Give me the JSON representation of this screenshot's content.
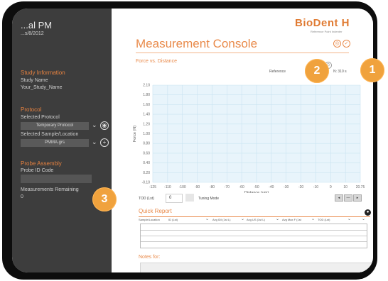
{
  "sidebar": {
    "time": "...al PM",
    "date": "...s/8/2012",
    "study_heading": "Study Information",
    "study_name_label": "Study Name",
    "study_name_value": "Your_Study_Name",
    "protocol_heading": "Protocol",
    "selected_protocol_label": "Selected Protocol",
    "selected_protocol_value": "Temporary Protocol",
    "selected_sample_label": "Selected Sample/Location",
    "selected_sample_value": "PMMA.grs",
    "probe_heading": "Probe Assembly",
    "probe_id_label": "Probe ID Code",
    "measurements_label": "Measurements Remaining",
    "measurements_value": "0"
  },
  "header": {
    "logo": "BioDent",
    "logo_suffix": "H",
    "logo_sub": "Reference Point Indenter",
    "title": "Measurement Console"
  },
  "chart": {
    "title": "Force vs. Distance",
    "reference_label": "Reference",
    "reference_value": "N: 310 s"
  },
  "chart_data": {
    "type": "line",
    "xlabel": "Distance (µm)",
    "ylabel": "Force (N)",
    "x_ticks": [
      "-125",
      "-110",
      "-100",
      "-90",
      "-80",
      "-70",
      "-60",
      "-50",
      "-40",
      "-30",
      "-20",
      "-10",
      "0",
      "10",
      "20.75"
    ],
    "y_ticks": [
      "2.10",
      "1.80",
      "1.60",
      "1.40",
      "1.20",
      "1.00",
      "0.80",
      "0.60",
      "0.40",
      "0.20",
      "-0.10"
    ],
    "xlim": [
      -125,
      20.75
    ],
    "ylim": [
      -0.1,
      2.1
    ],
    "grid": true,
    "series": [],
    "plot_color": "#e8f4fb",
    "grid_color": "#c9e3f1"
  },
  "controls": {
    "tod_label": "TOD (Lst)",
    "tod_value": "0",
    "tuning_label": "Tuning Mode",
    "pan_left": "◂",
    "pan_mid": "—",
    "pan_right": "▸"
  },
  "quick_report": {
    "title": "Quick Report",
    "columns": [
      "Sample/Location",
      "ID (Lst)",
      "Avg IDI (1st L)",
      "Avg US (1st L)",
      "Avg Max F (1st",
      "TOD (Lst)"
    ]
  },
  "notes": {
    "title": "Notes for:"
  },
  "badges": {
    "b1": "1",
    "b2": "2",
    "b3": "3",
    "color": "#f0a23d"
  }
}
